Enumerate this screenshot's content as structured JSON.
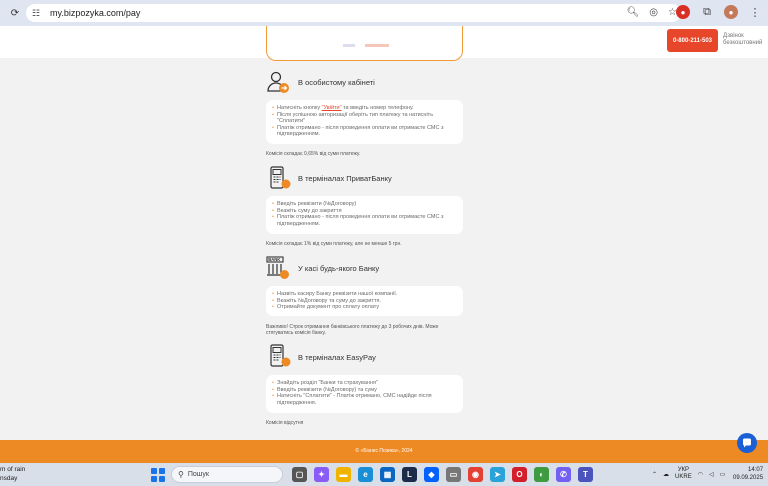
{
  "browser": {
    "url": "my.bizpozyka.com/pay"
  },
  "header": {
    "phone": "0-800-211-503",
    "free_call": "Дзвінок безкоштовний"
  },
  "sections": [
    {
      "title": "В особистому кабінеті",
      "icon": "user-arrow-icon",
      "items": [
        {
          "pre": "Натисніть кнопку ",
          "link": "\"Увійти\"",
          "post": " та введіть номер телефону."
        },
        {
          "pre": "Після успішною авторизації оберіть тип платежу та натисніть \"Сплатити\""
        },
        {
          "pre": "Платіж отримано - після проведення оплати ви отримаєте СМС з підтвердженням."
        }
      ],
      "note": "Комісія складає 0,65% від суми платежу."
    },
    {
      "title": "В терміналах ПриватБанку",
      "icon": "terminal-icon",
      "items": [
        {
          "pre": "Введіть реквізити (№Договору)"
        },
        {
          "pre": "Вкажіть суму до закриття"
        },
        {
          "pre": "Платіж отримано - після проведення оплати ви отримаєте СМС з підтвердженням."
        }
      ],
      "note": "Комісія складає 1% від суми платежу, але не менше 5 грн."
    },
    {
      "title": "У касі будь-якого Банку",
      "icon": "bank-icon",
      "items": [
        {
          "pre": "Назвіть касиру Банку реквізити нашої компанії."
        },
        {
          "pre": "Вкажіть №Договору та суму до закриття."
        },
        {
          "pre": "Отримайте документ про сплату оплату"
        }
      ],
      "note": "Важливо! Строк отримання банківського платежу до 3 робочих днів. Може стягуватись комісія банку."
    },
    {
      "title": "В терміналах EasyPay",
      "icon": "terminal-easypay-icon",
      "items": [
        {
          "pre": "Знайдіть розділ \"Банки та страхування\""
        },
        {
          "pre": "Введіть реквізити (№Договору) та суму"
        },
        {
          "pre": "Натисніть \"Сплатити\" - Платіж отримано, СМС надійде після підтвердження."
        }
      ],
      "note": "Комісія відсутня"
    }
  ],
  "footer": {
    "copyright": "© «Бізнес Позика», 2024"
  },
  "taskbar": {
    "weather_line1": "m of rain",
    "weather_line2": "nsday",
    "search_placeholder": "Пошук",
    "lang_line1": "УКР",
    "lang_line2": "UKRE",
    "time": "14:07",
    "date": "09.09.2025"
  },
  "colors": {
    "accent": "#ee8a24",
    "phone_btn": "#e8462a",
    "chat": "#1a5fd6"
  }
}
